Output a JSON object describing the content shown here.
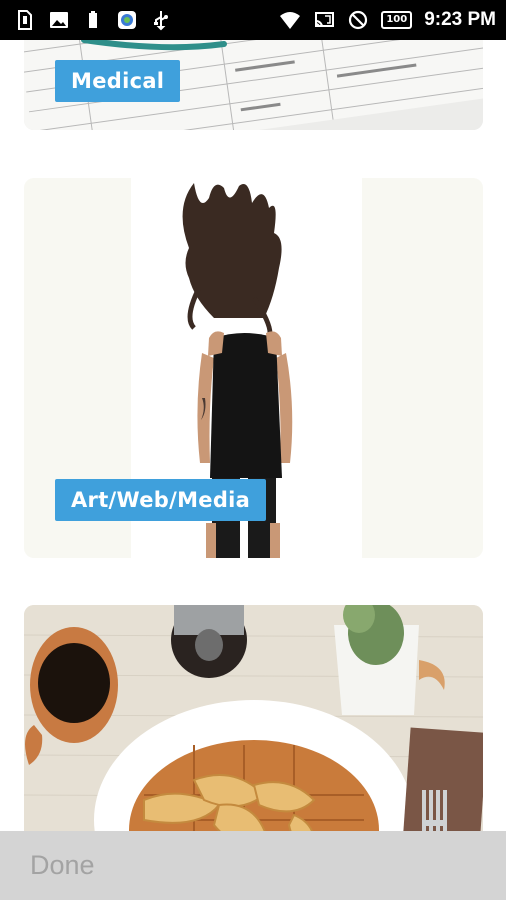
{
  "status_bar": {
    "time": "9:23 PM",
    "battery": "100",
    "icons_left": [
      "sim-icon",
      "image-icon",
      "battery-small-icon",
      "app-icon",
      "usb-icon"
    ],
    "icons_right": [
      "wifi-icon",
      "cast-icon",
      "do-not-disturb-icon",
      "battery-icon"
    ]
  },
  "categories": [
    {
      "label": "Medical",
      "image": "medical-documents-image"
    },
    {
      "label": "Art/Web/Media",
      "image": "woman-hair-flip-image"
    },
    {
      "label": "",
      "image": "waffle-breakfast-image"
    }
  ],
  "footer": {
    "done_label": "Done"
  },
  "colors": {
    "label_bg": "#3fa0dc",
    "status_bar": "#000000",
    "footer_bg": "#d4d4d4",
    "footer_text": "#a3a3a3"
  }
}
